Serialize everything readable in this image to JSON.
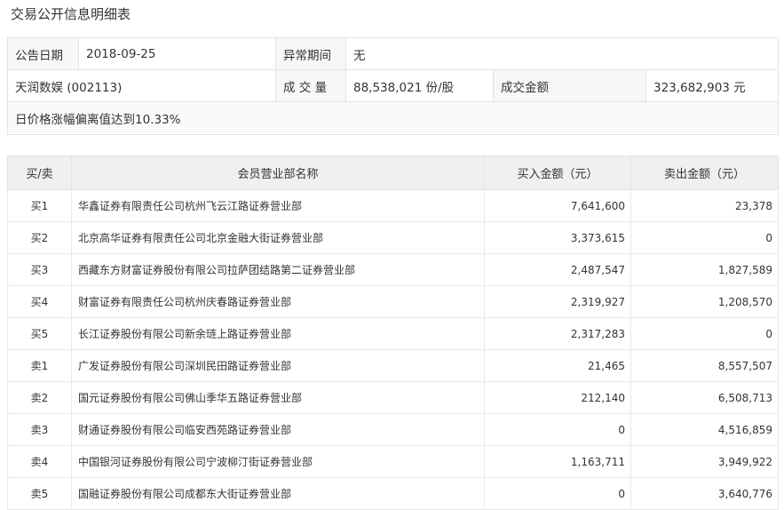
{
  "page_title": "交易公开信息明细表",
  "info": {
    "announce_date_label": "公告日期",
    "announce_date": "2018-09-25",
    "abnormal_period_label": "异常期间",
    "abnormal_period": "无",
    "stock": "天润数娱 (002113)",
    "volume_label": "成 交 量",
    "volume": "88,538,021 份/股",
    "amount_label": "成交金额",
    "amount": "323,682,903 元",
    "note": "日价格涨幅偏离值达到10.33%"
  },
  "table": {
    "headers": [
      "买/卖",
      "会员营业部名称",
      "买入金额（元）",
      "卖出金额（元）"
    ],
    "rows": [
      {
        "side": "买1",
        "name": "华鑫证券有限责任公司杭州飞云江路证券营业部",
        "buy": "7,641,600",
        "sell": "23,378"
      },
      {
        "side": "买2",
        "name": "北京高华证券有限责任公司北京金融大街证券营业部",
        "buy": "3,373,615",
        "sell": "0"
      },
      {
        "side": "买3",
        "name": "西藏东方财富证券股份有限公司拉萨团结路第二证券营业部",
        "buy": "2,487,547",
        "sell": "1,827,589"
      },
      {
        "side": "买4",
        "name": "财富证券有限责任公司杭州庆春路证券营业部",
        "buy": "2,319,927",
        "sell": "1,208,570"
      },
      {
        "side": "买5",
        "name": "长江证券股份有限公司新余琏上路证券营业部",
        "buy": "2,317,283",
        "sell": "0"
      },
      {
        "side": "卖1",
        "name": "广发证券股份有限公司深圳民田路证券营业部",
        "buy": "21,465",
        "sell": "8,557,507"
      },
      {
        "side": "卖2",
        "name": "国元证券股份有限公司佛山季华五路证券营业部",
        "buy": "212,140",
        "sell": "6,508,713"
      },
      {
        "side": "卖3",
        "name": "财通证券股份有限公司临安西苑路证券营业部",
        "buy": "0",
        "sell": "4,516,859"
      },
      {
        "side": "卖4",
        "name": "中国银河证券股份有限公司宁波柳汀街证券营业部",
        "buy": "1,163,711",
        "sell": "3,949,922"
      },
      {
        "side": "卖5",
        "name": "国融证券股份有限公司成都东大街证券营业部",
        "buy": "0",
        "sell": "3,640,776"
      }
    ]
  }
}
